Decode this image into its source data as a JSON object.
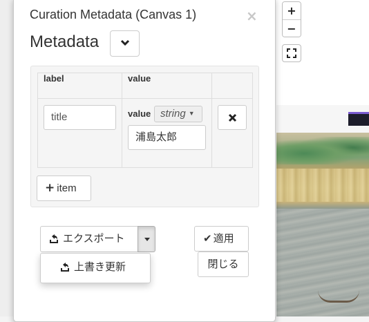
{
  "dialog": {
    "title": "Curation Metadata (Canvas 1)",
    "close_glyph": "×"
  },
  "metadata": {
    "heading": "Metadata",
    "collapse_icon": "chevron-down-icon",
    "columns": {
      "label": "label",
      "value": "value",
      "action": ""
    },
    "rows": [
      {
        "label_placeholder": "title",
        "value_prefix": "value",
        "value_type": "string",
        "value": "浦島太郎",
        "remove_icon": "times-icon"
      }
    ],
    "add_item_label": "item"
  },
  "actions": {
    "export_label": "エクスポート",
    "export_menu": [
      {
        "label": "上書き更新",
        "icon": "export-icon"
      }
    ],
    "apply_label": "適用",
    "close_label": "閉じる"
  },
  "viewer": {
    "zoom_in": "+",
    "zoom_out": "−",
    "fullscreen_icon": "fullscreen-icon"
  }
}
